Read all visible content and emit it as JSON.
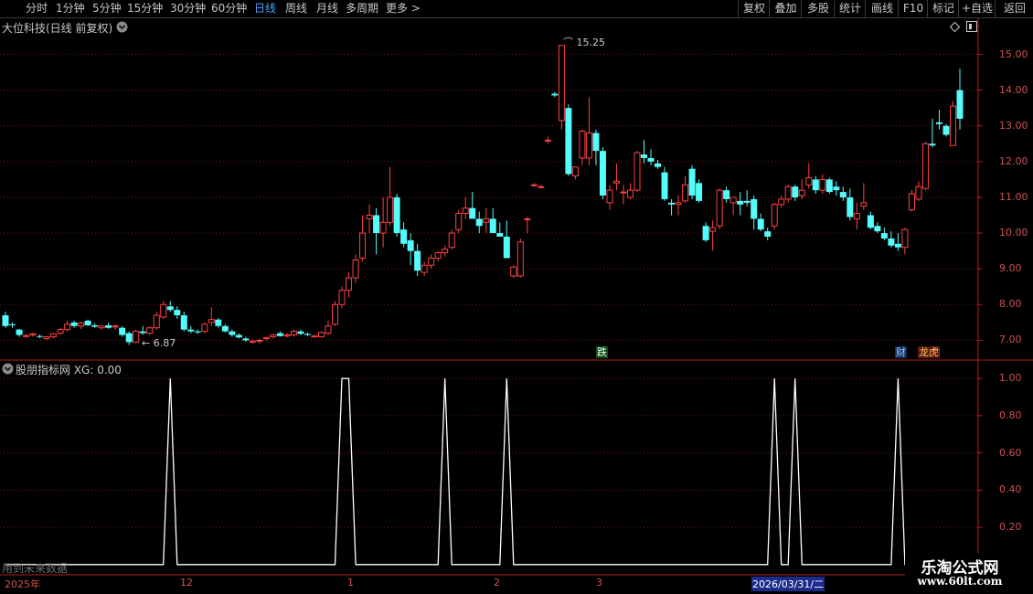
{
  "toolbar": {
    "periods": [
      "分时",
      "1分钟",
      "5分钟",
      "15分钟",
      "30分钟",
      "60分钟",
      "日线",
      "周线",
      "月线",
      "多周期",
      "更多 >"
    ],
    "active_period": "日线",
    "right_buttons": [
      "复权",
      "叠加",
      "多股",
      "统计",
      "画线",
      "F10",
      "标记",
      "+自选",
      "返回"
    ]
  },
  "main_panel": {
    "title": "大位科技(日线 前复权)",
    "high_label": "15.25",
    "low_label": "6.87",
    "markers": [
      "跌",
      "财",
      "龙虎榜"
    ]
  },
  "indicator_panel": {
    "title": "股朋指标网 XG: 0.00",
    "footer_note": "用到未来数据"
  },
  "time_axis": {
    "labels": [
      "2025年",
      "12",
      "1",
      "2",
      "3"
    ],
    "cursor_date": "2026/03/31/二"
  },
  "watermark": {
    "line1": "乐淘公式网",
    "line2": "www.60lt.com"
  },
  "chart_data": [
    {
      "type": "candlestick",
      "title": "大位科技(日线 前复权)",
      "y_ticks": [
        7.0,
        8.0,
        9.0,
        10.0,
        11.0,
        12.0,
        13.0,
        14.0,
        15.0
      ],
      "ylim": [
        6.55,
        15.55
      ],
      "up_color": "#ff4040",
      "down_color": "#54fcfc",
      "grid": true,
      "candles": [
        [
          7.7,
          7.8,
          7.35,
          7.4
        ],
        [
          7.45,
          7.5,
          7.35,
          7.42
        ],
        [
          7.3,
          7.32,
          7.1,
          7.15
        ],
        [
          7.12,
          7.18,
          7.08,
          7.13
        ],
        [
          7.15,
          7.22,
          7.1,
          7.18
        ],
        [
          7.12,
          7.16,
          7.06,
          7.1
        ],
        [
          7.05,
          7.12,
          7.0,
          7.1
        ],
        [
          7.1,
          7.2,
          7.05,
          7.18
        ],
        [
          7.2,
          7.35,
          7.15,
          7.3
        ],
        [
          7.3,
          7.55,
          7.25,
          7.45
        ],
        [
          7.5,
          7.55,
          7.35,
          7.4
        ],
        [
          7.4,
          7.52,
          7.32,
          7.48
        ],
        [
          7.55,
          7.58,
          7.4,
          7.42
        ],
        [
          7.42,
          7.48,
          7.35,
          7.38
        ],
        [
          7.35,
          7.42,
          7.3,
          7.4
        ],
        [
          7.42,
          7.5,
          7.32,
          7.35
        ],
        [
          7.38,
          7.45,
          7.3,
          7.4
        ],
        [
          7.35,
          7.4,
          7.1,
          7.15
        ],
        [
          7.2,
          7.25,
          6.87,
          6.95
        ],
        [
          6.95,
          7.3,
          6.92,
          7.25
        ],
        [
          7.25,
          7.4,
          7.15,
          7.2
        ],
        [
          7.2,
          7.38,
          7.15,
          7.35
        ],
        [
          7.35,
          7.8,
          7.3,
          7.7
        ],
        [
          7.65,
          8.1,
          7.6,
          8.0
        ],
        [
          7.95,
          8.1,
          7.8,
          7.85
        ],
        [
          7.85,
          7.95,
          7.6,
          7.7
        ],
        [
          7.7,
          7.8,
          7.25,
          7.3
        ],
        [
          7.3,
          7.4,
          7.2,
          7.25
        ],
        [
          7.25,
          7.3,
          7.18,
          7.22
        ],
        [
          7.25,
          7.5,
          7.2,
          7.45
        ],
        [
          7.5,
          7.92,
          7.4,
          7.58
        ],
        [
          7.58,
          7.62,
          7.35,
          7.4
        ],
        [
          7.4,
          7.45,
          7.22,
          7.25
        ],
        [
          7.25,
          7.3,
          7.1,
          7.15
        ],
        [
          7.15,
          7.2,
          7.05,
          7.08
        ],
        [
          7.05,
          7.1,
          6.95,
          7.0
        ],
        [
          6.95,
          7.02,
          6.9,
          6.98
        ],
        [
          6.98,
          7.05,
          6.9,
          7.0
        ],
        [
          7.05,
          7.1,
          7.0,
          7.08
        ],
        [
          7.1,
          7.18,
          7.05,
          7.15
        ],
        [
          7.2,
          7.25,
          7.1,
          7.12
        ],
        [
          7.12,
          7.2,
          7.08,
          7.15
        ],
        [
          7.15,
          7.3,
          7.1,
          7.25
        ],
        [
          7.25,
          7.3,
          7.15,
          7.18
        ],
        [
          7.18,
          7.22,
          7.12,
          7.15
        ],
        [
          7.12,
          7.15,
          7.1,
          7.12
        ],
        [
          7.1,
          7.25,
          7.08,
          7.22
        ],
        [
          7.2,
          7.55,
          7.15,
          7.4
        ],
        [
          7.45,
          8.1,
          7.4,
          8.0
        ],
        [
          8.0,
          8.5,
          7.9,
          8.4
        ],
        [
          8.4,
          8.9,
          8.2,
          8.75
        ],
        [
          8.75,
          9.4,
          8.6,
          9.25
        ],
        [
          9.3,
          10.5,
          9.2,
          10.0
        ],
        [
          10.4,
          10.8,
          10.0,
          10.5
        ],
        [
          10.5,
          10.7,
          9.4,
          10.0
        ],
        [
          10.0,
          11.0,
          9.6,
          10.3
        ],
        [
          10.3,
          11.85,
          10.2,
          11.0
        ],
        [
          11.0,
          11.1,
          9.9,
          10.0
        ],
        [
          10.1,
          10.3,
          9.6,
          9.7
        ],
        [
          9.8,
          10.0,
          9.1,
          9.5
        ],
        [
          9.5,
          9.7,
          8.8,
          8.95
        ],
        [
          8.9,
          9.2,
          8.8,
          9.1
        ],
        [
          9.1,
          9.4,
          9.0,
          9.3
        ],
        [
          9.3,
          9.5,
          9.2,
          9.45
        ],
        [
          9.45,
          9.65,
          9.35,
          9.55
        ],
        [
          9.6,
          10.1,
          9.55,
          10.0
        ],
        [
          10.1,
          10.65,
          10.0,
          10.55
        ],
        [
          10.55,
          11.0,
          10.4,
          10.7
        ],
        [
          10.7,
          11.15,
          10.5,
          10.4
        ],
        [
          10.4,
          10.6,
          10.0,
          10.2
        ],
        [
          10.3,
          10.7,
          10.0,
          10.4
        ],
        [
          10.4,
          10.7,
          10.2,
          10.0
        ],
        [
          10.0,
          10.3,
          9.9,
          9.9
        ],
        [
          9.9,
          10.35,
          9.8,
          9.3
        ],
        [
          8.8,
          9.1,
          8.75,
          9.05
        ],
        [
          8.8,
          9.85,
          8.75,
          9.75
        ],
        [
          10.4,
          10.45,
          10.0,
          10.4
        ],
        [
          11.35,
          11.4,
          11.3,
          11.35
        ],
        [
          11.3,
          11.35,
          11.25,
          11.3
        ],
        [
          12.6,
          12.7,
          12.5,
          12.6
        ],
        [
          13.9,
          13.95,
          13.8,
          13.85
        ],
        [
          13.15,
          15.25,
          12.9,
          15.25
        ],
        [
          13.5,
          13.6,
          11.6,
          11.65
        ],
        [
          11.6,
          11.85,
          11.5,
          11.85
        ],
        [
          12.1,
          12.9,
          11.9,
          12.85
        ],
        [
          12.1,
          13.8,
          11.9,
          12.8
        ],
        [
          12.8,
          12.9,
          11.9,
          12.3
        ],
        [
          12.3,
          12.4,
          10.95,
          11.05
        ],
        [
          10.85,
          11.35,
          10.65,
          11.2
        ],
        [
          11.4,
          11.95,
          11.2,
          11.45
        ],
        [
          11.15,
          11.35,
          10.8,
          11.15
        ],
        [
          11.0,
          11.4,
          10.95,
          11.2
        ],
        [
          11.2,
          12.3,
          11.15,
          12.25
        ],
        [
          12.2,
          12.6,
          11.95,
          12.1
        ],
        [
          12.1,
          12.35,
          11.9,
          12.0
        ],
        [
          11.95,
          12.05,
          11.8,
          11.85
        ],
        [
          11.7,
          11.85,
          10.9,
          10.95
        ],
        [
          10.85,
          10.95,
          10.5,
          10.8
        ],
        [
          10.8,
          11.05,
          10.5,
          10.85
        ],
        [
          10.9,
          11.6,
          10.85,
          11.35
        ],
        [
          11.8,
          11.9,
          10.95,
          11.05
        ],
        [
          11.4,
          11.5,
          10.85,
          10.9
        ],
        [
          10.2,
          10.3,
          9.75,
          9.8
        ],
        [
          10.05,
          10.35,
          9.5,
          10.15
        ],
        [
          10.2,
          11.25,
          10.1,
          11.2
        ],
        [
          11.2,
          11.3,
          10.85,
          10.95
        ],
        [
          10.85,
          11.0,
          10.5,
          11.0
        ],
        [
          10.9,
          11.15,
          10.5,
          10.8
        ],
        [
          10.9,
          11.2,
          10.75,
          10.85
        ],
        [
          10.95,
          11.05,
          10.1,
          10.4
        ],
        [
          10.4,
          10.55,
          10.05,
          10.1
        ],
        [
          10.05,
          10.15,
          9.8,
          9.9
        ],
        [
          10.2,
          10.85,
          10.1,
          10.8
        ],
        [
          10.8,
          11.05,
          10.7,
          10.95
        ],
        [
          10.95,
          11.35,
          10.85,
          11.3
        ],
        [
          11.3,
          11.35,
          10.9,
          11.0
        ],
        [
          11.05,
          11.5,
          10.95,
          11.2
        ],
        [
          11.35,
          11.95,
          11.25,
          11.55
        ],
        [
          11.5,
          11.6,
          11.1,
          11.2
        ],
        [
          11.2,
          11.65,
          11.1,
          11.5
        ],
        [
          11.5,
          11.55,
          11.1,
          11.15
        ],
        [
          11.3,
          11.45,
          11.05,
          11.2
        ],
        [
          11.15,
          11.3,
          10.9,
          11.0
        ],
        [
          11.0,
          11.25,
          10.35,
          10.45
        ],
        [
          10.4,
          10.85,
          10.1,
          10.55
        ],
        [
          10.75,
          11.4,
          10.65,
          10.85
        ],
        [
          10.5,
          10.6,
          10.1,
          10.15
        ],
        [
          10.2,
          10.3,
          10.0,
          10.05
        ],
        [
          10.0,
          10.15,
          9.8,
          9.85
        ],
        [
          9.85,
          10.05,
          9.6,
          9.65
        ],
        [
          9.7,
          10.0,
          9.5,
          9.6
        ],
        [
          9.6,
          10.15,
          9.4,
          10.1
        ],
        [
          10.65,
          11.2,
          10.6,
          11.1
        ],
        [
          10.95,
          11.45,
          10.9,
          11.3
        ],
        [
          11.25,
          12.55,
          11.2,
          12.5
        ],
        [
          12.5,
          13.2,
          12.4,
          12.45
        ],
        [
          13.1,
          13.45,
          12.9,
          13.05
        ],
        [
          13.0,
          13.05,
          12.7,
          12.75
        ],
        [
          12.45,
          13.7,
          12.45,
          13.55
        ],
        [
          14.0,
          14.6,
          12.9,
          13.2
        ]
      ]
    },
    {
      "type": "line",
      "title": "股朋指标网 XG: 0.00",
      "series": [
        {
          "name": "XG",
          "color": "#ffffff"
        }
      ],
      "y_ticks": [
        0.2,
        0.4,
        0.6,
        0.8,
        1.0
      ],
      "ylim": [
        -0.05,
        1.05
      ],
      "values": [
        0,
        0,
        0,
        0,
        0,
        0,
        0,
        0,
        0,
        0,
        0,
        0,
        0,
        0,
        0,
        0,
        0,
        0,
        0,
        0,
        0,
        0,
        0,
        0,
        1,
        0,
        0,
        0,
        0,
        0,
        0,
        0,
        0,
        0,
        0,
        0,
        0,
        0,
        0,
        0,
        0,
        0,
        0,
        0,
        0,
        0,
        0,
        0,
        0,
        1,
        1,
        0,
        0,
        0,
        0,
        0,
        0,
        0,
        0,
        0,
        0,
        0,
        0,
        0,
        1,
        0,
        0,
        0,
        0,
        0,
        0,
        0,
        0,
        1,
        0,
        0,
        0,
        0,
        0,
        0,
        0,
        0,
        0,
        0,
        0,
        0,
        0,
        0,
        0,
        0,
        0,
        0,
        0,
        0,
        0,
        0,
        0,
        0,
        0,
        0,
        0,
        0,
        0,
        0,
        0,
        0,
        0,
        0,
        0,
        0,
        0,
        0,
        1,
        0,
        0,
        1,
        0,
        0,
        0,
        0,
        0,
        0,
        0,
        0,
        0,
        0,
        0,
        0,
        0,
        0,
        1,
        0,
        0,
        0,
        0,
        0
      ]
    }
  ]
}
